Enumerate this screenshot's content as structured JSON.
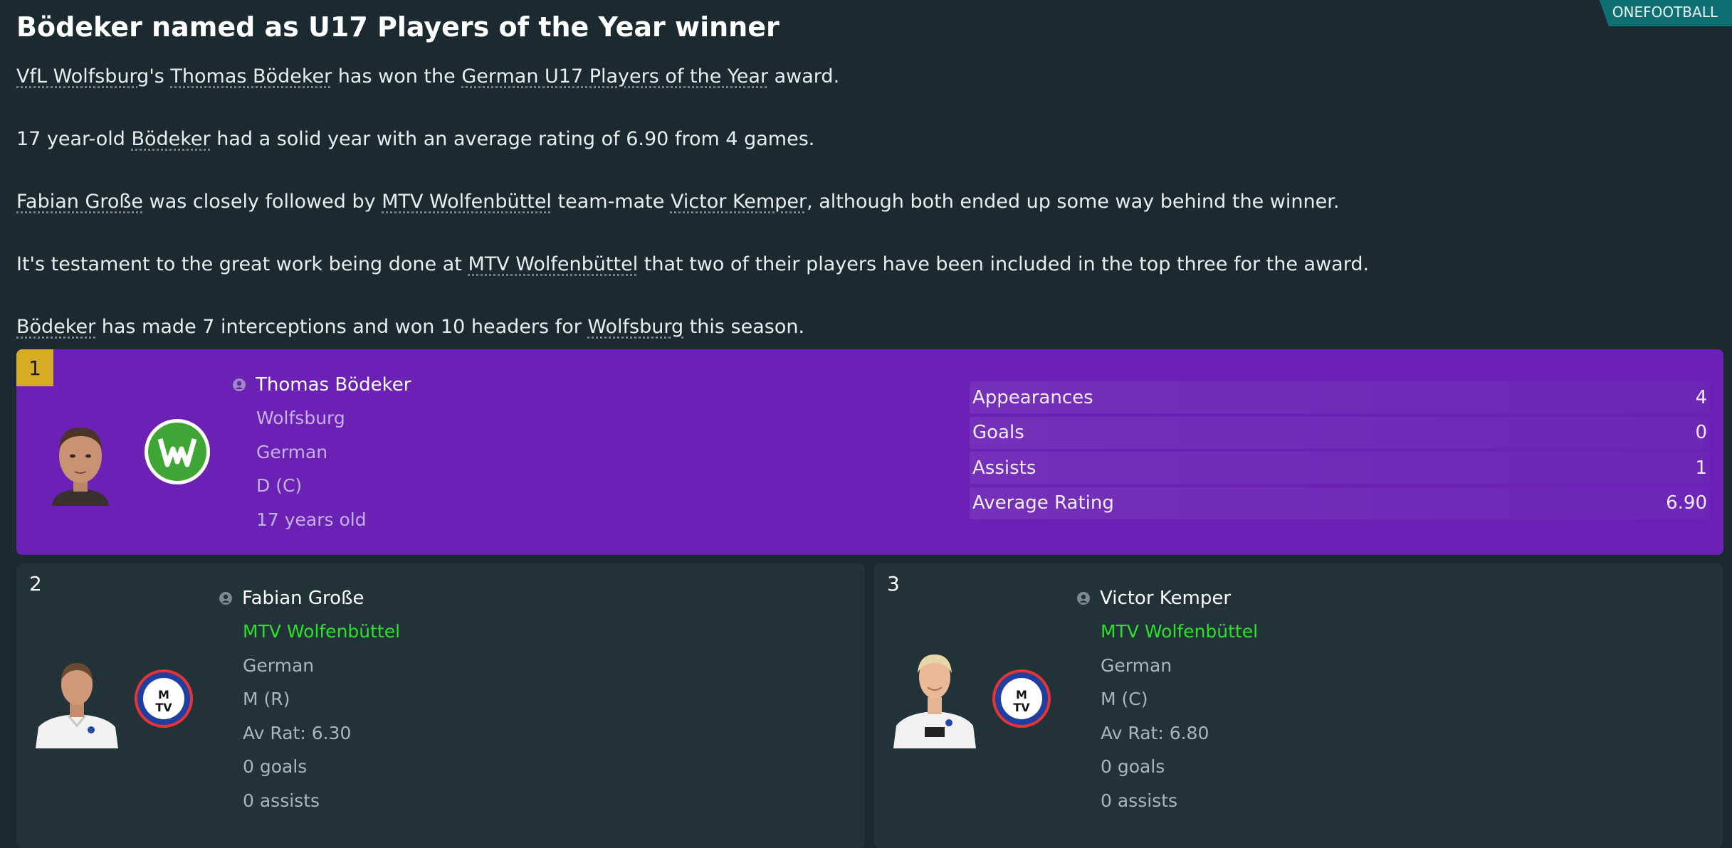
{
  "source_tag": "ONEFOOTBALL",
  "headline": "Bödeker named as U17 Players of the Year winner",
  "article": {
    "p1": {
      "a": "VfL Wolfsburg",
      "b": "'s ",
      "c": "Thomas Bödeker",
      "d": " has won the ",
      "e": "German U17 Players of the Year",
      "f": " award."
    },
    "p2": {
      "a": "17 year-old ",
      "b": "Bödeker",
      "c": " had a solid year with an average rating of 6.90 from 4 games."
    },
    "p3": {
      "a": "Fabian Große",
      "b": " was closely followed by ",
      "c": "MTV Wolfenbüttel",
      "d": " team-mate ",
      "e": "Victor Kemper",
      "f": ", although both ended up some way behind the winner."
    },
    "p4": {
      "a": "It's testament to the great work being done at ",
      "b": "MTV Wolfenbüttel",
      "c": " that two of their players have been included in the top three for the award."
    },
    "p5": {
      "a": "Bödeker",
      "b": " has made 7 interceptions and won 10 headers for ",
      "c": "Wolfsburg",
      "d": " this season."
    }
  },
  "winner": {
    "rank": "1",
    "name": "Thomas Bödeker",
    "club": "Wolfsburg",
    "nationality": "German",
    "position": "D (C)",
    "age": "17 years old",
    "stats": [
      {
        "label": "Appearances",
        "value": "4"
      },
      {
        "label": "Goals",
        "value": "0"
      },
      {
        "label": "Assists",
        "value": "1"
      },
      {
        "label": "Average Rating",
        "value": "6.90"
      }
    ]
  },
  "runners": [
    {
      "rank": "2",
      "name": "Fabian Große",
      "club": "MTV Wolfenbüttel",
      "nationality": "German",
      "position": "M (R)",
      "rating": "Av Rat: 6.30",
      "goals": "0 goals",
      "assists": "0 assists"
    },
    {
      "rank": "3",
      "name": "Victor Kemper",
      "club": "MTV Wolfenbüttel",
      "nationality": "German",
      "position": "M (C)",
      "rating": "Av Rat: 6.80",
      "goals": "0 goals",
      "assists": "0 assists"
    }
  ],
  "colors": {
    "winner_bg": "#6a21b4",
    "rank_gold": "#d6ac24",
    "club_link": "#2fe02b",
    "source_tag": "#0f6f72"
  }
}
